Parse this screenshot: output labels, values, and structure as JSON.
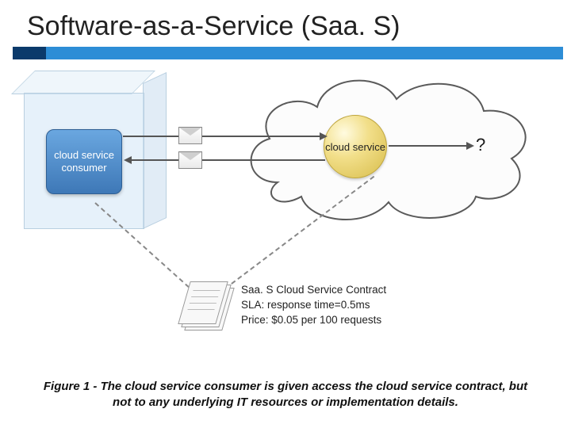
{
  "title": "Software-as-a-Service (Saa. S)",
  "diagram": {
    "consumer_label": "cloud service consumer",
    "service_label": "cloud service",
    "question_mark": "?",
    "contract": {
      "line1": "Saa. S Cloud Service Contract",
      "line2": "SLA: response time=0.5ms",
      "line3": "Price: $0.05 per 100 requests"
    }
  },
  "caption": "Figure 1 - The cloud service consumer is given access the cloud service contract, but not to any underlying IT resources or implementation details."
}
